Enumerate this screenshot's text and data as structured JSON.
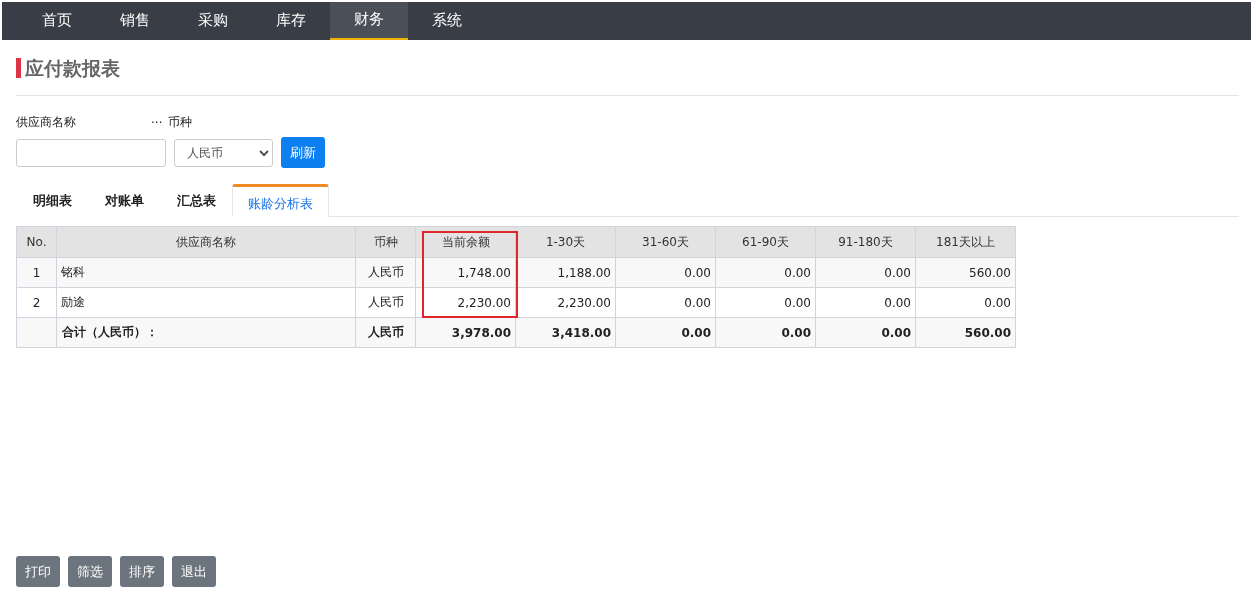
{
  "nav": [
    {
      "label": "首页",
      "selected": false
    },
    {
      "label": "销售",
      "selected": false
    },
    {
      "label": "采购",
      "selected": false
    },
    {
      "label": "库存",
      "selected": false
    },
    {
      "label": "财务",
      "selected": true
    },
    {
      "label": "系统",
      "selected": false
    }
  ],
  "page_title": "应付款报表",
  "filters": {
    "supplier_label": "供应商名称",
    "supplier_more": "···",
    "currency_label": "币种",
    "currency": "人民币",
    "refresh": "刷新"
  },
  "tabs": [
    {
      "label": "明细表",
      "selected": false
    },
    {
      "label": "对账单",
      "selected": false
    },
    {
      "label": "汇总表",
      "selected": false
    },
    {
      "label": "账龄分析表",
      "selected": true
    }
  ],
  "table": {
    "columns": [
      {
        "label": "No.",
        "highlighted": false
      },
      {
        "label": "供应商名称",
        "highlighted": false
      },
      {
        "label": "币种",
        "highlighted": false
      },
      {
        "label": "当前余额",
        "highlighted": true
      },
      {
        "label": "1-30天",
        "highlighted": false
      },
      {
        "label": "31-60天",
        "highlighted": false
      },
      {
        "label": "61-90天",
        "highlighted": false
      },
      {
        "label": "91-180天",
        "highlighted": false
      },
      {
        "label": "181天以上",
        "highlighted": false
      }
    ],
    "rows": [
      [
        "1",
        "铭科",
        "人民币",
        "1,748.00",
        "1,188.00",
        "0.00",
        "0.00",
        "0.00",
        "560.00"
      ],
      [
        "2",
        "励途",
        "人民币",
        "2,230.00",
        "2,230.00",
        "0.00",
        "0.00",
        "0.00",
        "0.00"
      ]
    ],
    "total": {
      "label": "合计（人民币）：",
      "cells": [
        "人民币",
        "3,978.00",
        "3,418.00",
        "0.00",
        "0.00",
        "0.00",
        "560.00"
      ]
    }
  },
  "actions": [
    "打印",
    "筛选",
    "排序",
    "退出"
  ]
}
